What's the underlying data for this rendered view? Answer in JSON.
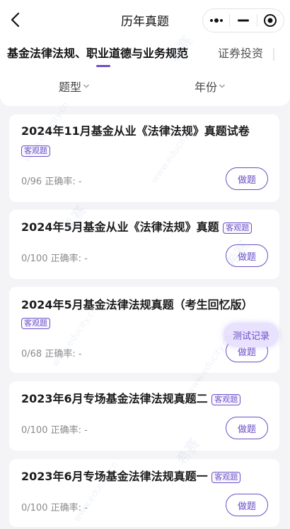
{
  "nav": {
    "title": "历年真题"
  },
  "tabs": [
    {
      "label": "基金法律法规、职业道德与业务规范"
    },
    {
      "label": "证券投资"
    }
  ],
  "filters": {
    "type_label": "题型",
    "year_label": "年份"
  },
  "cards": [
    {
      "title": "2024年11月基金从业《法律法规》真题试卷",
      "badge": "客观题",
      "stats": "0/96 正确率: -",
      "action": "做题"
    },
    {
      "title": "2024年5月基金从业《法律法规》真题",
      "badge": "客观题",
      "stats": "0/100 正确率: -",
      "action": "做题"
    },
    {
      "title": "2024年5月基金法律法规真题（考生回忆版）",
      "badge": "客观题",
      "stats": "0/68 正确率: -",
      "action": "做题"
    },
    {
      "title": "2023年6月专场基金法律法规真题二",
      "badge": "客观题",
      "stats": "0/100 正确率: -",
      "action": "做题"
    },
    {
      "title": "2023年6月专场基金法律法规真题一",
      "badge": "客观题",
      "stats": "0/100 正确率: -",
      "action": "做题"
    }
  ],
  "float_button": {
    "label": "测试记录"
  },
  "watermark": {
    "brand": "希赛",
    "url": "www.educity.cn"
  },
  "colors": {
    "accent": "#6a4fc6",
    "background": "#f4f4f7",
    "float_bg": "#e9e2ff"
  }
}
